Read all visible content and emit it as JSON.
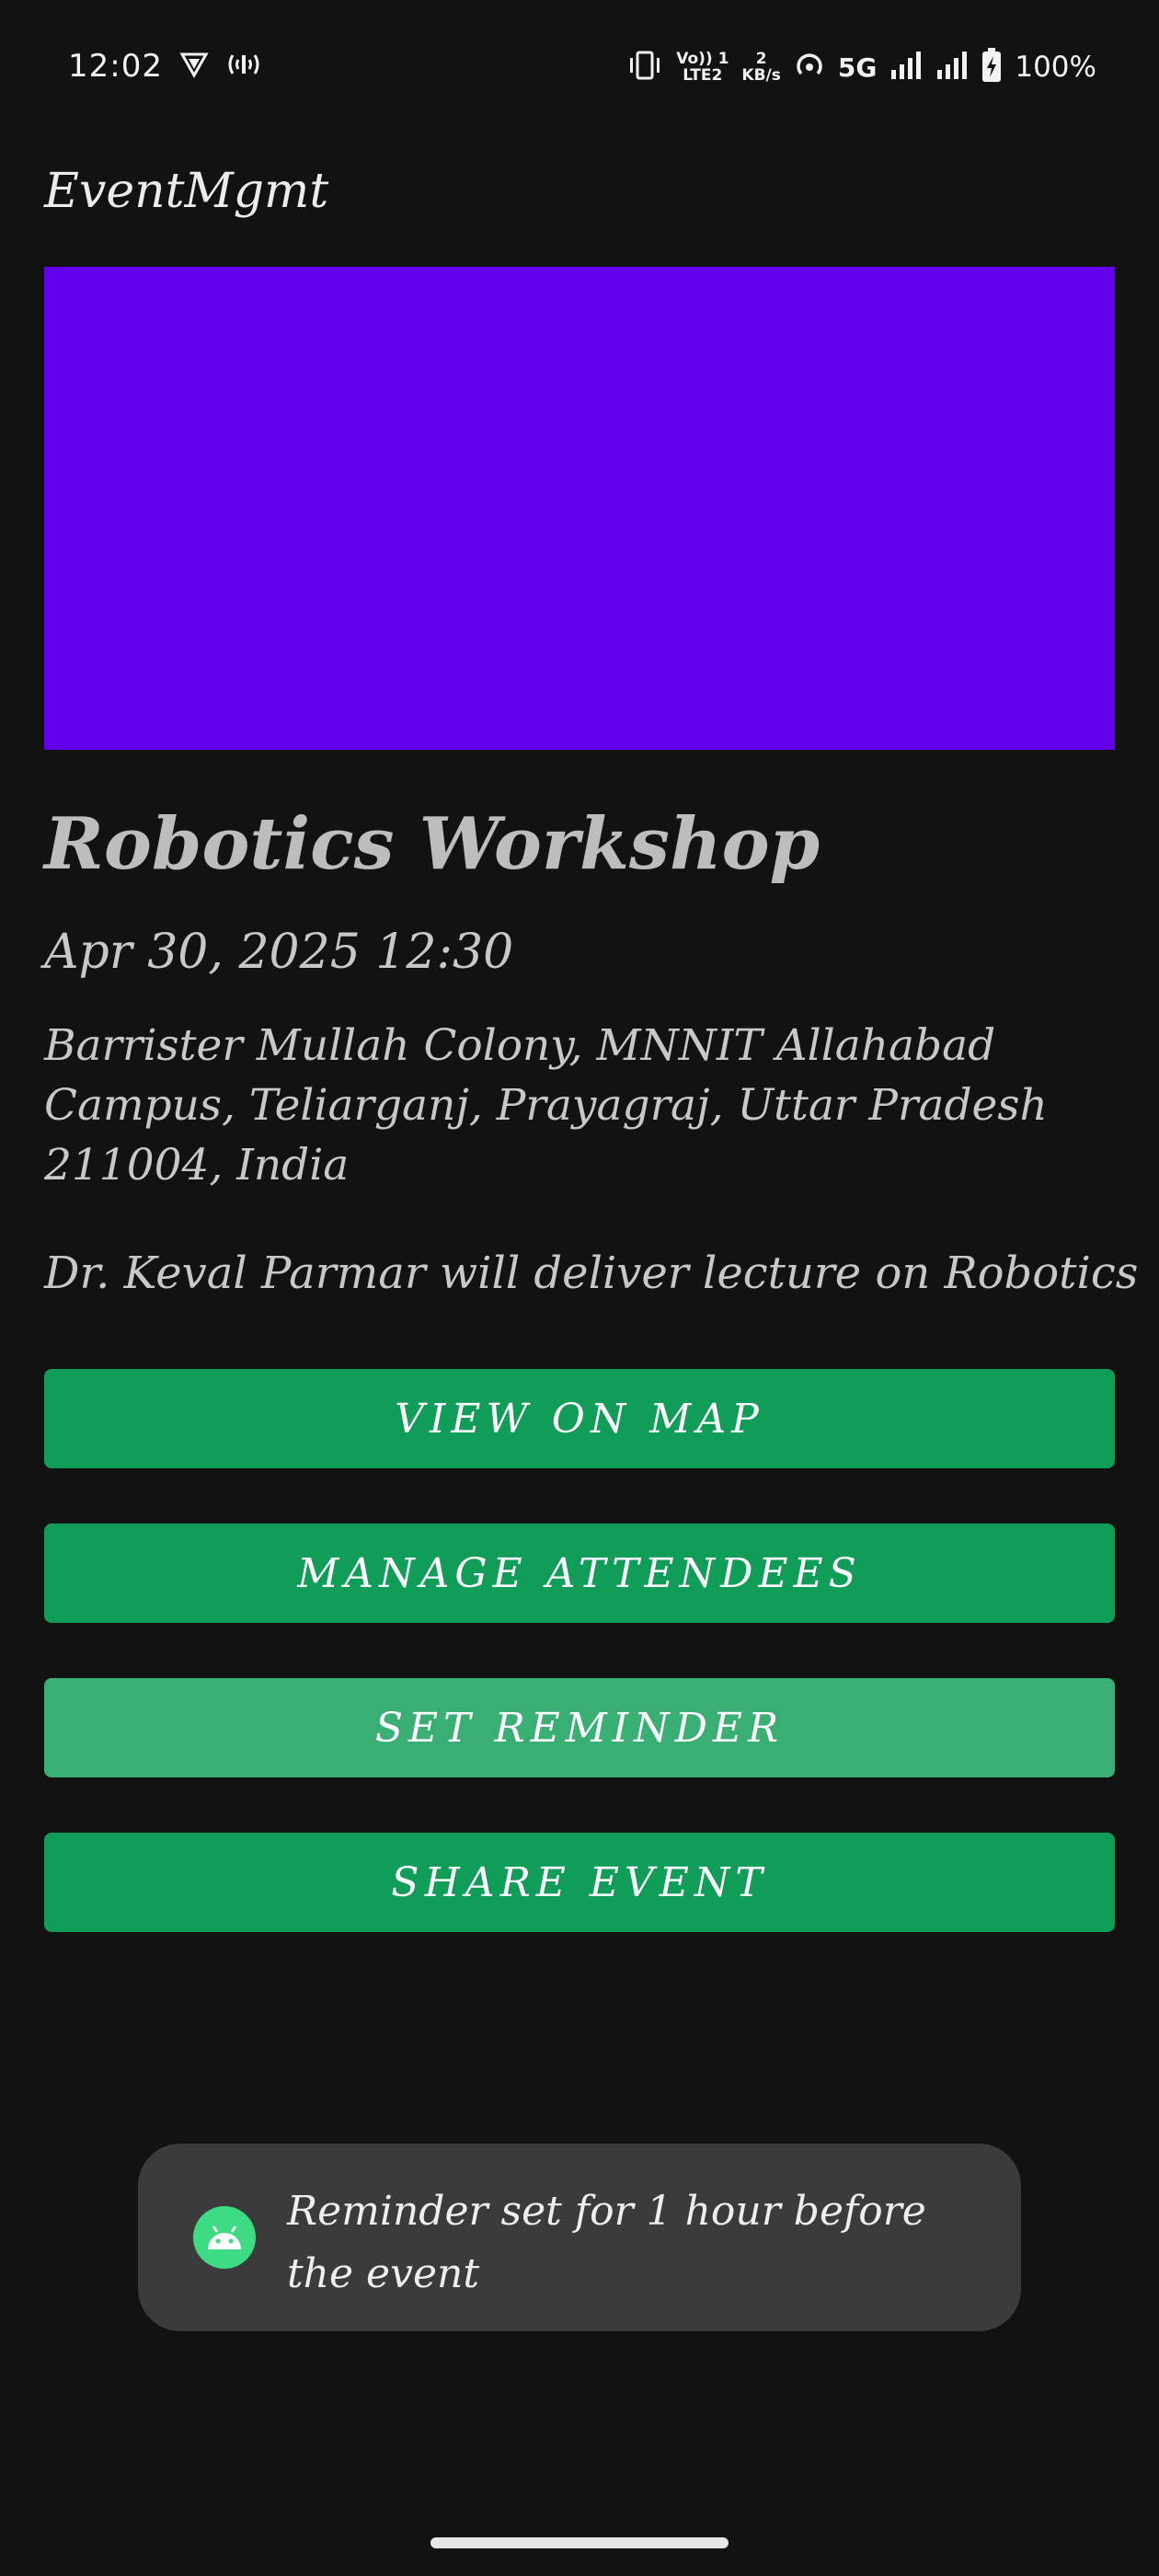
{
  "status_bar": {
    "time": "12:02",
    "volte_top": "Vo)) 1",
    "volte_bottom": "LTE2",
    "speed_top": "2",
    "speed_bottom": "KB/s",
    "network": "5G",
    "battery": "100%",
    "icons": [
      "vpn-shield-icon",
      "hotspot-icon",
      "vibrate-icon",
      "wifi-hotspot-icon",
      "signal-icon",
      "signal-icon",
      "battery-charging-icon"
    ]
  },
  "app_bar": {
    "title": "EventMgmt"
  },
  "banner": {
    "color": "#6200ee"
  },
  "event": {
    "title": "Robotics Workshop",
    "datetime": "Apr 30, 2025 12:30",
    "address": "Barrister Mullah Colony, MNNIT Allahabad Campus, Teliarganj, Prayagraj, Uttar Pradesh 211004, India",
    "description": "Dr. Keval Parmar will deliver lecture on Robotics"
  },
  "buttons": {
    "view_on_map": "VIEW ON MAP",
    "manage_attendees": "MANAGE ATTENDEES",
    "set_reminder": "SET REMINDER",
    "share_event": "SHARE EVENT",
    "color": "#0f9d58"
  },
  "toast": {
    "icon": "android-icon",
    "message": "Reminder set for 1 hour before the event"
  }
}
